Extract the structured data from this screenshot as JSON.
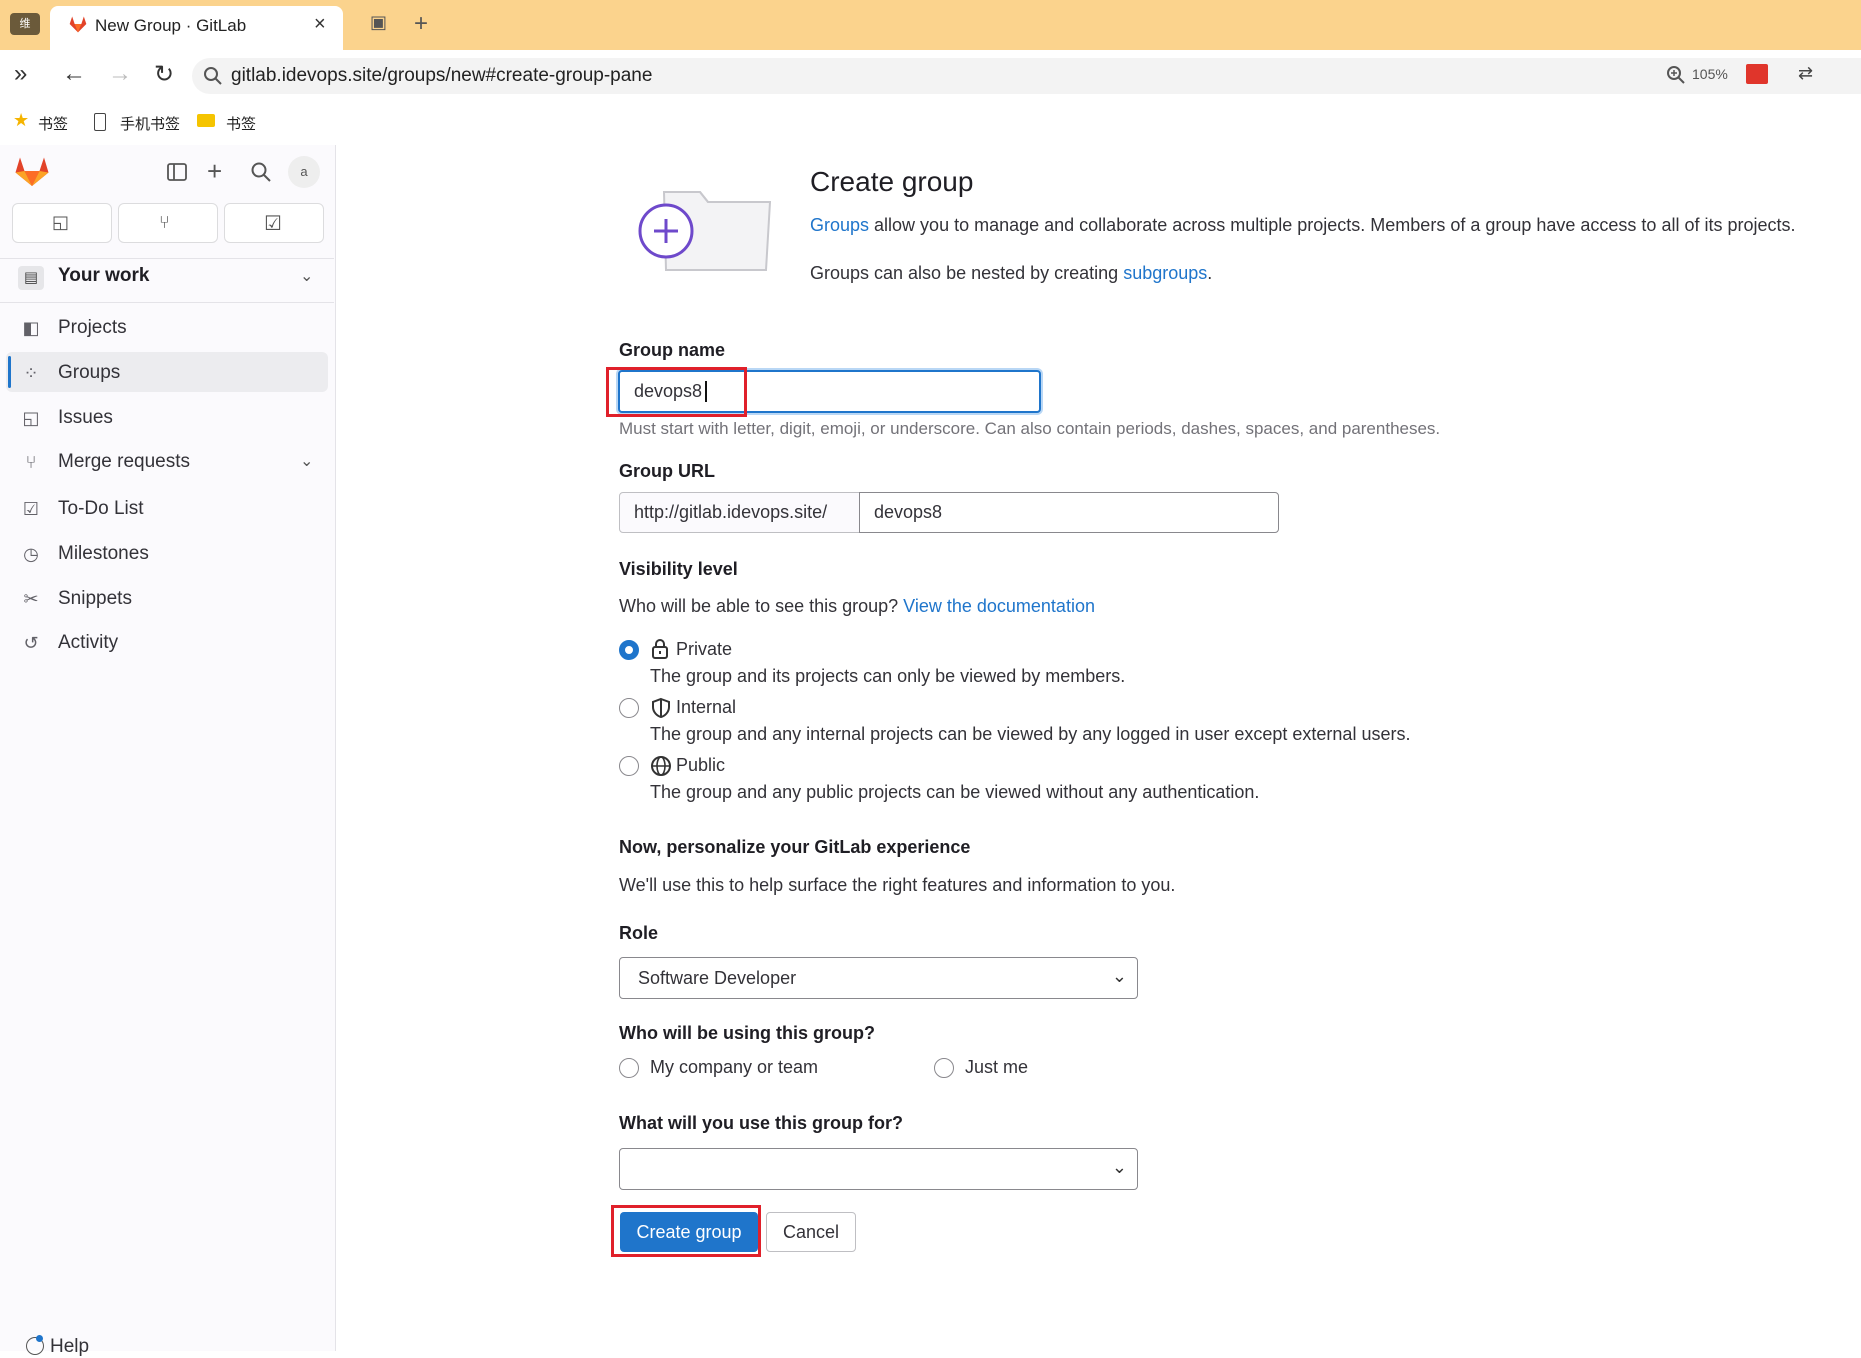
{
  "browser": {
    "tab_title": "New Group · GitLab",
    "close_glyph": "×",
    "new_tab_glyph": "+",
    "side_box_text": "维",
    "url": "gitlab.idevops.site/groups/new#create-group-pane",
    "zoom": "105%",
    "bookmarks": [
      {
        "label": "书签",
        "icon": "star-icon"
      },
      {
        "label": "手机书签",
        "icon": "phone-icon"
      },
      {
        "label": "书签",
        "icon": "folder-icon"
      }
    ]
  },
  "sidebar": {
    "avatar_alt": "a",
    "section_title": "Your work",
    "items": [
      {
        "label": "Projects",
        "icon": "project-icon"
      },
      {
        "label": "Groups",
        "icon": "group-icon"
      },
      {
        "label": "Issues",
        "icon": "issues-icon"
      },
      {
        "label": "Merge requests",
        "icon": "merge-request-icon"
      },
      {
        "label": "To-Do List",
        "icon": "todo-icon"
      },
      {
        "label": "Milestones",
        "icon": "milestone-icon"
      },
      {
        "label": "Snippets",
        "icon": "snippet-icon"
      },
      {
        "label": "Activity",
        "icon": "history-icon"
      }
    ],
    "help_label": "Help"
  },
  "header": {
    "title": "Create group",
    "desc1_link": "Groups",
    "desc1_rest": " allow you to manage and collaborate across multiple projects. Members of a group have access to all of its projects.",
    "desc2_text": "Groups can also be nested by creating ",
    "desc2_link": "subgroups",
    "desc2_end": "."
  },
  "form": {
    "group_name_label": "Group name",
    "group_name_value": "devops8",
    "group_name_help": "Must start with letter, digit, emoji, or underscore. Can also contain periods, dashes, spaces, and parentheses.",
    "group_url_label": "Group URL",
    "group_url_prefix": "http://gitlab.idevops.site/",
    "group_url_value": "devops8",
    "visibility_label": "Visibility level",
    "visibility_question": "Who will be able to see this group? ",
    "visibility_link": "View the documentation",
    "visibility_options": [
      {
        "label": "Private",
        "icon": "lock-icon",
        "desc": "The group and its projects can only be viewed by members.",
        "checked": true
      },
      {
        "label": "Internal",
        "icon": "shield-icon",
        "desc": "The group and any internal projects can be viewed by any logged in user except external users.",
        "checked": false
      },
      {
        "label": "Public",
        "icon": "globe-icon",
        "desc": "The group and any public projects can be viewed without any authentication.",
        "checked": false
      }
    ],
    "personalize_title": "Now, personalize your GitLab experience",
    "personalize_desc": "We'll use this to help surface the right features and information to you.",
    "role_label": "Role",
    "role_value": "Software Developer",
    "who_label": "Who will be using this group?",
    "who_options": [
      "My company or team",
      "Just me"
    ],
    "use_label": "What will you use this group for?",
    "use_value": "",
    "create_button": "Create group",
    "cancel_button": "Cancel"
  },
  "colors": {
    "accent": "#1f75cb",
    "highlight": "#e0202a",
    "tabbar": "#fbd38d"
  }
}
